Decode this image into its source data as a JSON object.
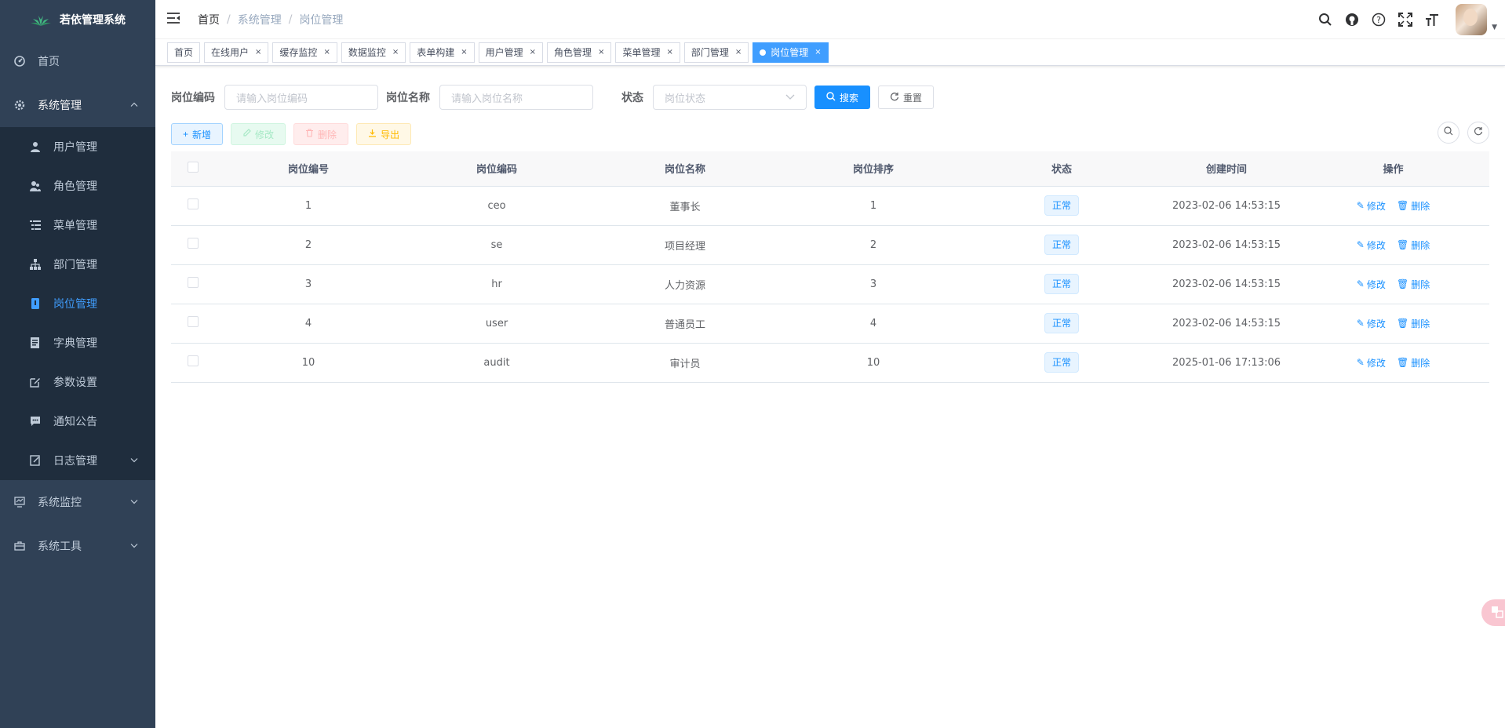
{
  "app": {
    "title": "若依管理系统"
  },
  "sidebar": {
    "home": "首页",
    "system": "系统管理",
    "system_children": [
      {
        "label": "用户管理",
        "icon": "user-icon"
      },
      {
        "label": "角色管理",
        "icon": "peoples-icon"
      },
      {
        "label": "菜单管理",
        "icon": "tree-table-icon"
      },
      {
        "label": "部门管理",
        "icon": "tree-icon"
      },
      {
        "label": "岗位管理",
        "icon": "post-icon",
        "active": true
      },
      {
        "label": "字典管理",
        "icon": "dict-icon"
      },
      {
        "label": "参数设置",
        "icon": "edit-icon"
      },
      {
        "label": "通知公告",
        "icon": "message-icon"
      },
      {
        "label": "日志管理",
        "icon": "log-icon"
      }
    ],
    "monitor": "系统监控",
    "tool": "系统工具"
  },
  "breadcrumb": {
    "home": "首页",
    "level1": "系统管理",
    "level2": "岗位管理"
  },
  "tags": [
    {
      "label": "首页"
    },
    {
      "label": "在线用户"
    },
    {
      "label": "缓存监控"
    },
    {
      "label": "数据监控"
    },
    {
      "label": "表单构建"
    },
    {
      "label": "用户管理"
    },
    {
      "label": "角色管理"
    },
    {
      "label": "菜单管理"
    },
    {
      "label": "部门管理"
    },
    {
      "label": "岗位管理",
      "active": true
    }
  ],
  "tag_close": "×",
  "search": {
    "code_label": "岗位编码",
    "code_placeholder": "请输入岗位编码",
    "name_label": "岗位名称",
    "name_placeholder": "请输入岗位名称",
    "status_label": "状态",
    "status_placeholder": "岗位状态",
    "search_btn": "搜索",
    "reset_btn": "重置"
  },
  "toolbar": {
    "add": "新增",
    "edit": "修改",
    "delete": "删除",
    "export": "导出"
  },
  "table": {
    "headers": [
      "岗位编号",
      "岗位编码",
      "岗位名称",
      "岗位排序",
      "状态",
      "创建时间",
      "操作"
    ],
    "rows": [
      {
        "id": "1",
        "code": "ceo",
        "name": "董事长",
        "sort": "1",
        "status": "正常",
        "time": "2023-02-06 14:53:15"
      },
      {
        "id": "2",
        "code": "se",
        "name": "项目经理",
        "sort": "2",
        "status": "正常",
        "time": "2023-02-06 14:53:15"
      },
      {
        "id": "3",
        "code": "hr",
        "name": "人力资源",
        "sort": "3",
        "status": "正常",
        "time": "2023-02-06 14:53:15"
      },
      {
        "id": "4",
        "code": "user",
        "name": "普通员工",
        "sort": "4",
        "status": "正常",
        "time": "2023-02-06 14:53:15"
      },
      {
        "id": "10",
        "code": "audit",
        "name": "审计员",
        "sort": "10",
        "status": "正常",
        "time": "2025-01-06 17:13:06"
      }
    ],
    "op_edit": "修改",
    "op_delete": "删除"
  },
  "colors": {
    "sidebar_bg": "#304156",
    "submenu_bg": "#1f2d3d",
    "primary": "#1890ff",
    "active_menu": "#409eff"
  }
}
